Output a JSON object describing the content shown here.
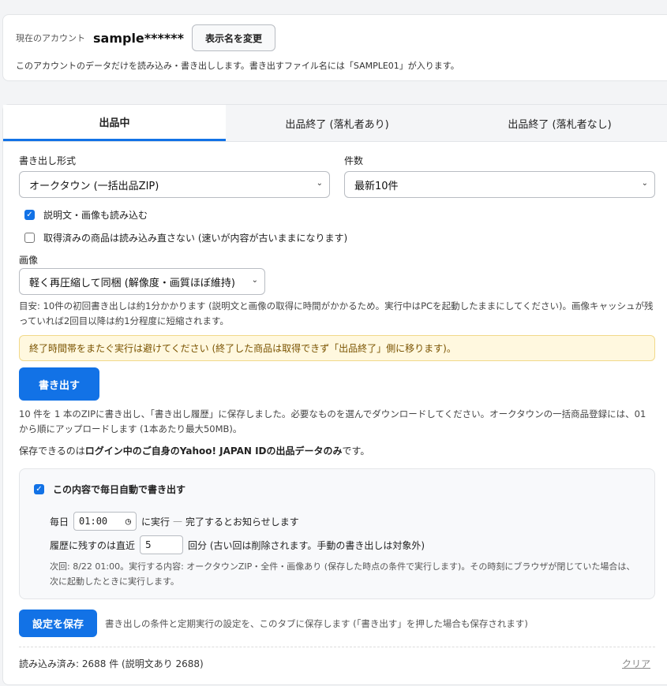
{
  "account": {
    "label": "現在のアカウント",
    "name": "sample******",
    "rename_button": "表示名を変更",
    "note": "このアカウントのデータだけを読み込み・書き出しします。書き出すファイル名には「SAMPLE01」が入ります。"
  },
  "tabs": [
    {
      "label": "出品中",
      "active": true
    },
    {
      "label": "出品終了 (落札者あり)",
      "active": false
    },
    {
      "label": "出品終了 (落札者なし)",
      "active": false
    }
  ],
  "form": {
    "format_label": "書き出し形式",
    "format_value": "オークタウン (一括出品ZIP)",
    "count_label": "件数",
    "count_value": "最新10件",
    "checkbox_desc": "説明文・画像も読み込む",
    "checkbox_desc_checked": true,
    "checkbox_skip": "取得済みの商品は読み込み直さない (速いが内容が古いままになります)",
    "checkbox_skip_checked": false,
    "image_label": "画像",
    "image_value": "軽く再圧縮して同梱 (解像度・画質ほぼ維持)"
  },
  "estimate_text": "目安: 10件の初回書き出しは約1分かかります (説明文と画像の取得に時間がかかるため。実行中はPCを起動したままにしてください)。画像キャッシュが残っていれば2回目以降は約1分程度に短縮されます。",
  "warning_text": "終了時間帯をまたぐ実行は避けてください (終了した商品は取得できず「出品終了」側に移ります)。",
  "export_button": "書き出す",
  "result_text": "10 件を 1 本のZIPに書き出し、「書き出し履歴」に保存しました。必要なものを選んでダウンロードしてください。オークタウンの一括商品登録には、01 から順にアップロードします (1本あたり最大50MB)。",
  "storage_note": {
    "prefix": "保存できるのは",
    "strong": "ログイン中のご自身のYahoo! JAPAN IDの出品データのみ",
    "suffix": "です。"
  },
  "auto": {
    "title": "この内容で毎日自動で書き出す",
    "checked": true,
    "daily_label": "毎日",
    "time_value": "01:00",
    "run_label": "に実行",
    "dash": "—",
    "notify_text": "完了するとお知らせします",
    "keep_label": "履歴に残すのは直近",
    "keep_value": "5",
    "keep_suffix": "回分 (古い回は削除されます。手動の書き出しは対象外)",
    "next_note": "次回: 8/22 01:00。実行する内容: オークタウンZIP・全件・画像あり (保存した時点の条件で実行します)。その時刻にブラウザが閉じていた場合は、次に起動したときに実行します。"
  },
  "save": {
    "button": "設定を保存",
    "desc": "書き出しの条件と定期実行の設定を、このタブに保存します (「書き出す」を押した場合も保存されます)"
  },
  "footer": {
    "count_text": "読み込み済み: 2688 件 (説明文あり 2688)",
    "clear_link": "クリア"
  },
  "colors": {
    "accent": "#1272e6",
    "warning_bg": "#fff8df",
    "warning_text": "#7a5300"
  }
}
